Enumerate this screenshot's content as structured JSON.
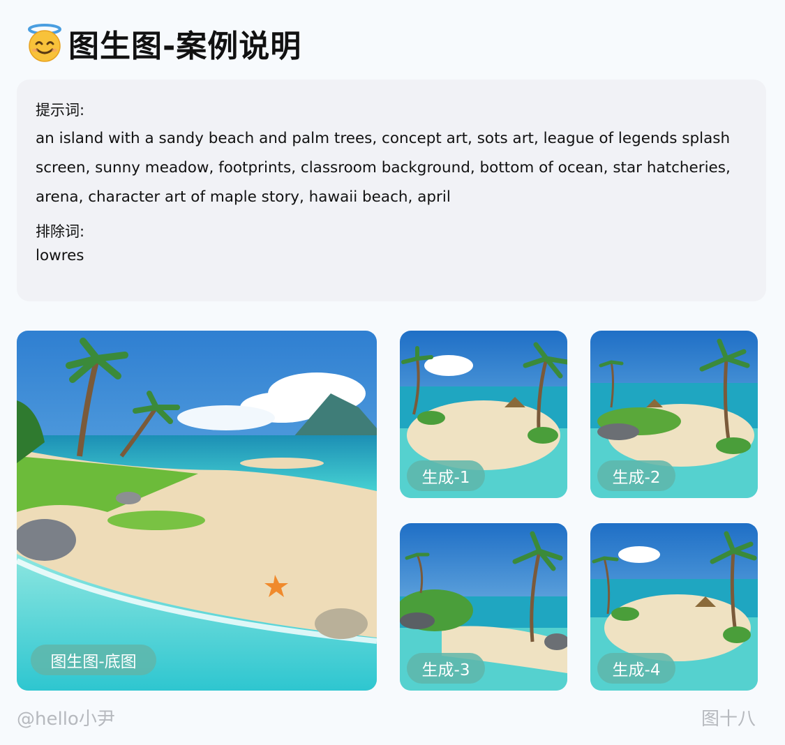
{
  "header": {
    "emoji_icon": "smiling-face-with-halo",
    "title": "图生图-案例说明"
  },
  "prompt_box": {
    "prompt_label": "提示词:",
    "prompt_text": "an island with a sandy beach and palm trees, concept art, sots art, league of legends splash screen, sunny meadow, footprints, classroom background, bottom of ocean, star hatcheries, arena, character art of maple story, hawaii beach, april",
    "negative_label": "排除词:",
    "negative_text": "lowres"
  },
  "images": {
    "base_label": "图生图-底图",
    "gen1_label": "生成-1",
    "gen2_label": "生成-2",
    "gen3_label": "生成-3",
    "gen4_label": "生成-4"
  },
  "footer": {
    "author": "@hello小尹",
    "figure_label": "图十八"
  },
  "colors": {
    "badge": "#5fb6aa",
    "footer_text": "#b6b9be"
  }
}
